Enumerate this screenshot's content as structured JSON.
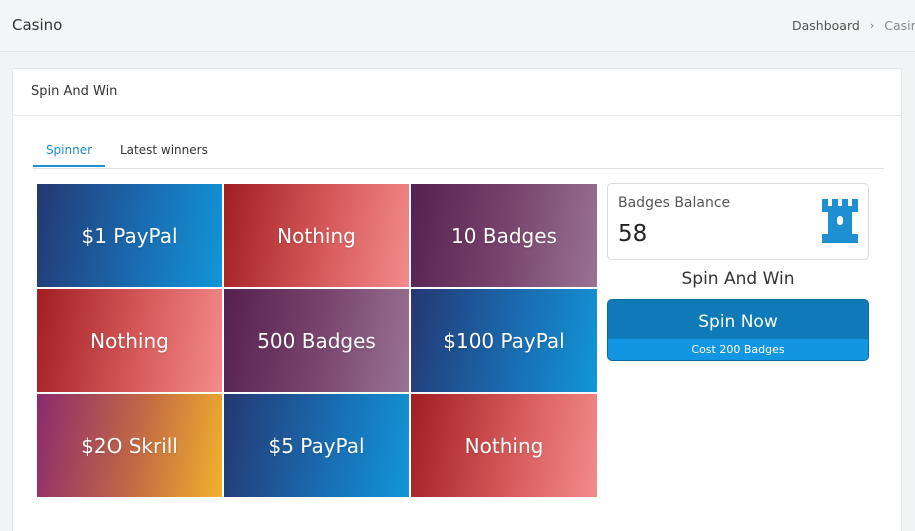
{
  "header": {
    "title": "Casino",
    "breadcrumb": {
      "items": [
        "Dashboard",
        "Casino"
      ]
    }
  },
  "card": {
    "title": "Spin And Win",
    "tabs": [
      {
        "label": "Spinner",
        "active": true
      },
      {
        "label": "Latest winners",
        "active": false
      }
    ]
  },
  "spinner": {
    "cells": [
      {
        "label": "$1 PayPal",
        "style": "blue"
      },
      {
        "label": "Nothing",
        "style": "red"
      },
      {
        "label": "10 Badges",
        "style": "purple"
      },
      {
        "label": "Nothing",
        "style": "red"
      },
      {
        "label": "500 Badges",
        "style": "purple"
      },
      {
        "label": "$100 PayPal",
        "style": "blue"
      },
      {
        "label": "$2O Skrill",
        "style": "skrill"
      },
      {
        "label": "$5 PayPal",
        "style": "blue"
      },
      {
        "label": "Nothing",
        "style": "red"
      }
    ]
  },
  "balance": {
    "label": "Badges Balance",
    "value": "58",
    "icon": "castle-icon"
  },
  "spin": {
    "heading": "Spin And Win",
    "button_label": "Spin Now",
    "cost_label": "Cost 200 Badges"
  },
  "colors": {
    "accent": "#1e8fd0",
    "button": "#0e7ab8",
    "icon": "#1e8fd0"
  }
}
